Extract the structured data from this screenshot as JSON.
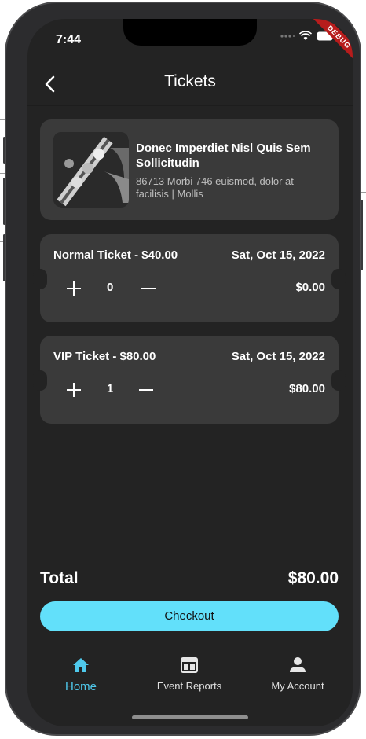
{
  "status_bar": {
    "time": "7:44",
    "debug_banner": "DEBUG"
  },
  "header": {
    "title": "Tickets"
  },
  "event": {
    "name": "Donec Imperdiet Nisl Quis Sem Sollicitudin",
    "location": "86713 Morbi 746 euismod, dolor at facilisis | Mollis"
  },
  "tickets": [
    {
      "label": "Normal Ticket - $40.00",
      "date": "Sat, Oct 15, 2022",
      "quantity": "0",
      "subtotal": "$0.00"
    },
    {
      "label": "VIP Ticket - $80.00",
      "date": "Sat, Oct 15, 2022",
      "quantity": "1",
      "subtotal": "$80.00"
    }
  ],
  "summary": {
    "total_label": "Total",
    "total_value": "$80.00",
    "checkout_label": "Checkout"
  },
  "bottom_nav": [
    {
      "label": "Home",
      "icon": "home-icon",
      "active": true
    },
    {
      "label": "Event Reports",
      "icon": "calendar-report-icon",
      "active": false
    },
    {
      "label": "My Account",
      "icon": "person-icon",
      "active": false
    }
  ],
  "colors": {
    "accent": "#62e0fa",
    "nav_active": "#4fc9ec",
    "background": "#232323",
    "card": "#3a3a3a"
  }
}
